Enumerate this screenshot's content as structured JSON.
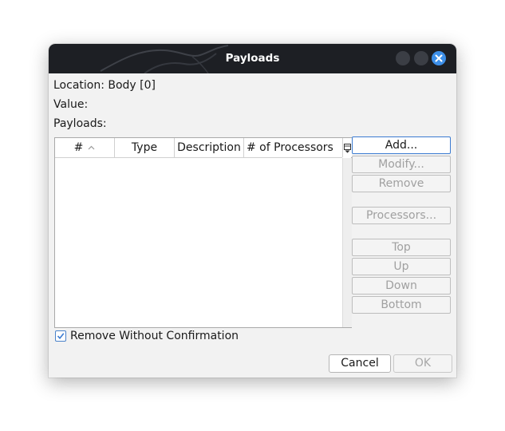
{
  "dialog": {
    "title": "Payloads"
  },
  "fields": {
    "location": "Location: Body [0]",
    "value": "Value:",
    "payloads_label": "Payloads:"
  },
  "table": {
    "columns": [
      "#",
      "Type",
      "Description",
      "# of Processors"
    ],
    "sorted_column": "#",
    "rows": []
  },
  "side_buttons": {
    "add": "Add...",
    "modify": "Modify...",
    "remove": "Remove",
    "processors": "Processors...",
    "top": "Top",
    "up": "Up",
    "down": "Down",
    "bottom": "Bottom"
  },
  "options": {
    "remove_without_confirmation_label": "Remove Without Confirmation",
    "remove_without_confirmation_checked": true
  },
  "footer": {
    "cancel": "Cancel",
    "ok": "OK"
  },
  "colors": {
    "titlebar": "#1d1f24",
    "close_button": "#3d8fe8",
    "focus_accent": "#3b7bd1"
  }
}
